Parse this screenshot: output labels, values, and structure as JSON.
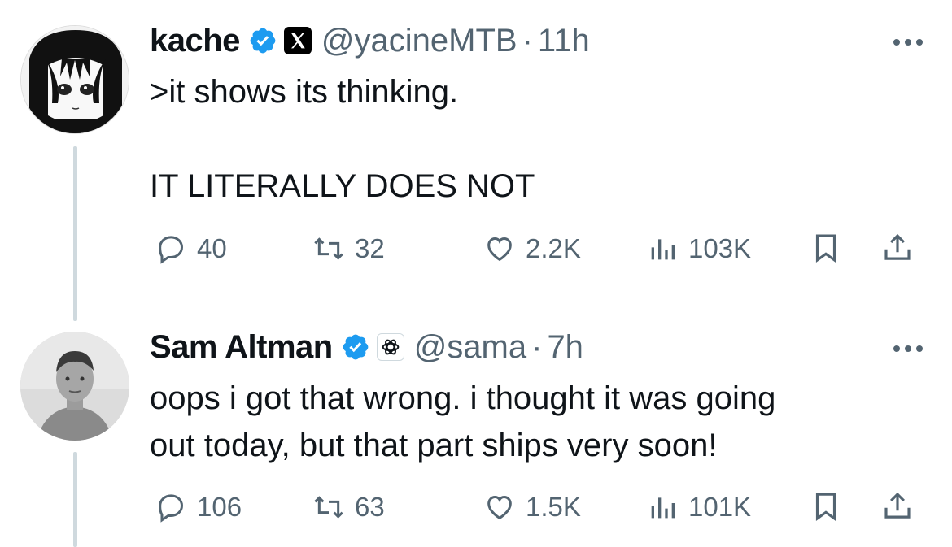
{
  "tweets": [
    {
      "name": "kache",
      "handle": "@yacineMTB",
      "separator": "·",
      "time": "11h",
      "text": ">it shows its thinking.\n\nIT LITERALLY DOES NOT",
      "replies": "40",
      "retweets": "32",
      "likes": "2.2K",
      "views": "103K",
      "affiliation_icon": "x-logo-icon"
    },
    {
      "name": "Sam Altman",
      "handle": "@sama",
      "separator": "·",
      "time": "7h",
      "text": "oops i got that wrong. i thought it was going\nout today, but that part ships very soon!",
      "replies": "106",
      "retweets": "63",
      "likes": "1.5K",
      "views": "101K",
      "affiliation_icon": "openai-logo-icon"
    }
  ],
  "colors": {
    "verified": "#1d9bf0",
    "secondary_text": "#536471",
    "primary_text": "#0f1419",
    "thread_line": "#cfd9de"
  }
}
